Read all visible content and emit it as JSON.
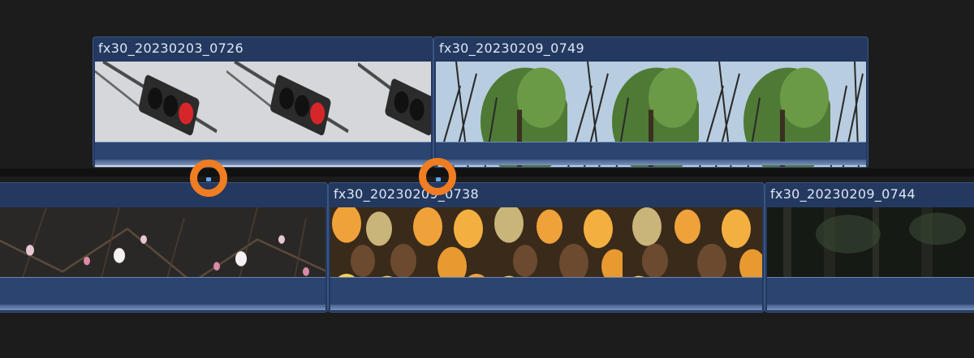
{
  "timeline": {
    "connected_clips": [
      {
        "name": "fx30_20230203_0726",
        "thumbnail": "traffic-light"
      },
      {
        "name": "fx30_20230209_0749",
        "thumbnail": "trees-sky"
      }
    ],
    "primary_clips": [
      {
        "name": "",
        "thumbnail": "plum-blossoms"
      },
      {
        "name": "fx30_20230209_0738",
        "thumbnail": "citrus-and-pinecones"
      },
      {
        "name": "fx30_20230209_0744",
        "thumbnail": "dark-forest"
      }
    ]
  },
  "colors": {
    "clip_fill": "#24395f",
    "clip_border": "#3b5584",
    "highlight": "#f07d22",
    "marker": "#63a7ff"
  }
}
